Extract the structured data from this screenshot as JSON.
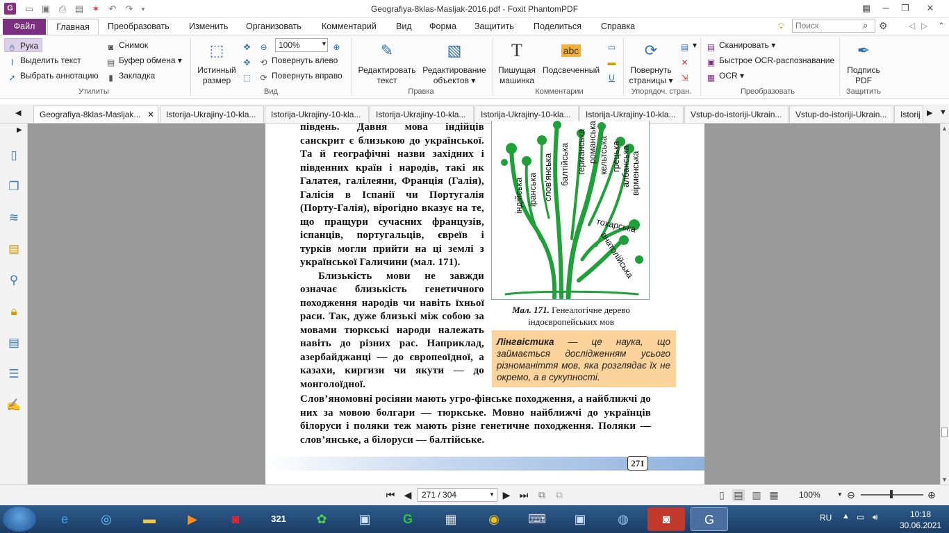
{
  "window": {
    "title": "Geografiya-8klas-Masljak-2016.pdf - Foxit PhantomPDF"
  },
  "ribbon_tabs": [
    "Файл",
    "Главная",
    "Преобразовать",
    "Изменить",
    "Организовать",
    "Комментарий",
    "Вид",
    "Форма",
    "Защитить",
    "Поделиться",
    "Справка"
  ],
  "search": {
    "placeholder": "Поиск"
  },
  "ribbon": {
    "utilities": {
      "label": "Утилиты",
      "hand": "Рука",
      "select_text": "Выделить текст",
      "select_annot": "Выбрать аннотацию",
      "snapshot": "Снимок",
      "clipboard": "Буфер обмена",
      "bookmark": "Закладка"
    },
    "view": {
      "label": "Вид",
      "actual_size": "Истинный размер",
      "zoom": "100%",
      "rotate_left": "Повернуть влево",
      "rotate_right": "Повернуть вправо"
    },
    "edit": {
      "label": "Правка",
      "edit_text": "Редактировать текст",
      "edit_objects": "Редактирование объектов"
    },
    "comments": {
      "label": "Комментарии",
      "typewriter": "Пишущая машинка",
      "highlight": "Подсвеченный",
      "abc": "abc"
    },
    "pages": {
      "label": "Упорядоч. стран.",
      "rotate_pages": "Повернуть страницы"
    },
    "convert": {
      "label": "Преобразовать",
      "scan": "Сканировать",
      "quick_ocr": "Быстрое OCR-распознавание",
      "ocr": "OCR"
    },
    "protect": {
      "label": "Защитить",
      "sign": "Подпись PDF"
    }
  },
  "doc_tabs": [
    "Geografiya-8klas-Masljak...",
    "Istorija-Ukrajiny-10-kla...",
    "Istorija-Ukrajiny-10-kla...",
    "Istorija-Ukrajiny-10-kla...",
    "Istorija-Ukrajiny-10-kla...",
    "Istorija-Ukrajiny-10-kla...",
    "Vstup-do-istoriji-Ukrain...",
    "Vstup-do-istoriji-Ukrain...",
    "Istorij"
  ],
  "page": {
    "col_text": "південь. Давня мова індійців санскрит є близькою до української. Та й географічні назви західних і південних країн і народів, такі як Галатея, галілеяни, Франція (Галія), Галісія в Іспанії чи Португалія (Порту-Галія), вірогідно вказує на те, що пращури сучасних французів, іспанців, португальців, євреїв і турків могли прийти на ці землі з української Галичини (мал. 171).",
    "col_text2": "Близькість мови не завжди означає близькість генетичного походження народів чи навіть їхньої раси. Так, дуже близькі між собою за мовами тюркські народи належать навіть до різних рас. Наприклад, азербайджанці — до європеоїдної, а казахи, киргизи чи якути — до монголоїдної.",
    "full_text": "Слов’яномовні росіяни мають угро-фінське походження, а найближчі до них за мовою болгари — тюркське. Мовно найближчі до українців білоруси і поляки теж мають різне генетичне походження. Поляки — слов’янське, а білоруси — балтійське.",
    "tree_labels": [
      "індійська",
      "іранська",
      "слов’янська",
      "балтійська",
      "германська",
      "романська",
      "кельтська",
      "грецька",
      "албанська",
      "вірменська",
      "тохарська",
      "анатолійська"
    ],
    "caption_ref": "Мал. 171.",
    "caption": "Генеалогічне дерево індоєвропейських мов",
    "def_term": "Лінгвістика",
    "def_text": "— це наука, що займається дослідженням усього різноманіття мов, яка розглядає їх не окремо, а в сукупності.",
    "page_number": "271"
  },
  "status": {
    "page_field": "271 / 304",
    "zoom": "100%"
  },
  "tray": {
    "lang": "RU",
    "time": "10:18",
    "date": "30.06.2021"
  },
  "taskbar_icons": [
    "ie-icon",
    "edge-like-icon",
    "explorer-icon",
    "media-icon",
    "screenshot-icon",
    "321-player-icon",
    "clover-icon",
    "control-icon",
    "g-icon",
    "calculator-icon",
    "chrome-icon",
    "keyboard-icon",
    "save-icon",
    "qb-icon",
    "camera-icon",
    "foxit-icon"
  ]
}
